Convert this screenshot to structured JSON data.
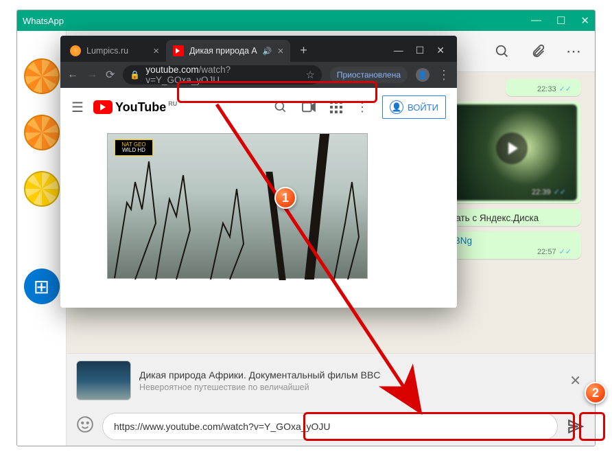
{
  "whatsapp": {
    "title": "WhatsApp",
    "header_icons": {
      "search": "🔍",
      "attach": "📎",
      "menu": "⋯"
    },
    "win": {
      "min": "—",
      "max": "☐",
      "close": "✕"
    },
    "messages": {
      "time1": "22:33",
      "video_time": "22:39",
      "msg3": "скачать с Яндекс.Диска",
      "msg4_link": "onNBNg",
      "time3": "22:57"
    },
    "preview": {
      "title": "Дикая природа Африки. Документальный фильм BBC",
      "sub": "Невероятное путешествие по величайшей"
    },
    "input": {
      "value": "https://www.youtube.com/watch?v=Y_GOxa_yOJU",
      "emoji": "☺"
    }
  },
  "browser": {
    "tabs": {
      "t1": "Lumpics.ru",
      "t2": "Дикая природа А"
    },
    "winctrl": {
      "min": "—",
      "max": "☐",
      "close": "✕"
    },
    "nav": {
      "back": "←",
      "fwd": "→",
      "reload": "⟳"
    },
    "url_host": "youtube.com",
    "url_path": "/watch?v=Y_GOxa_yOJU",
    "paused": "Приостановлена",
    "youtube": {
      "brand": "YouTube",
      "ru": "RU",
      "login": "ВОЙТИ",
      "wild1": "NAT GEO",
      "wild2": "WILD HD"
    }
  },
  "steps": {
    "s1": "1",
    "s2": "2"
  }
}
